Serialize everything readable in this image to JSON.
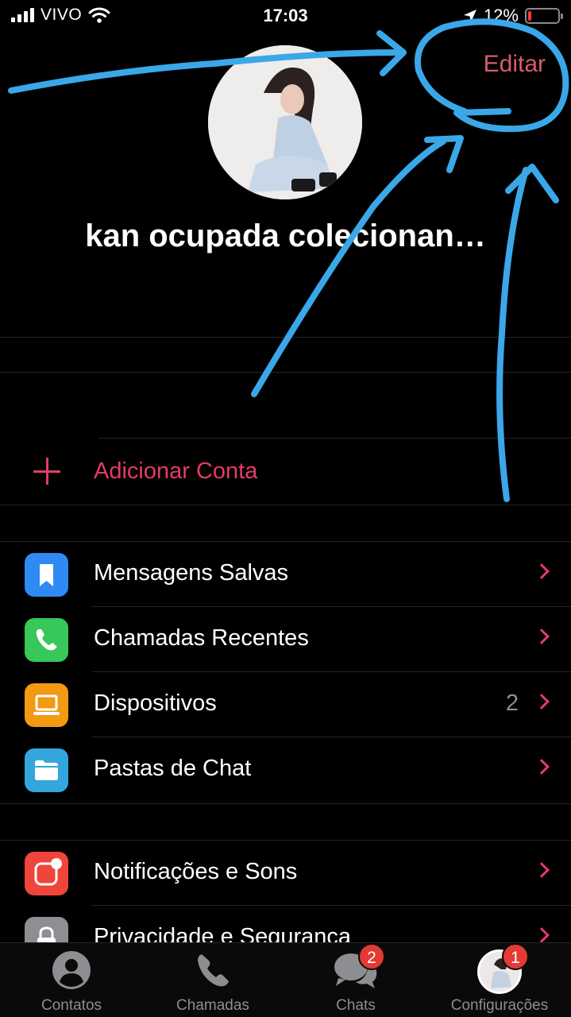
{
  "status_bar": {
    "carrier": "VIVO",
    "time": "17:03",
    "battery_percent": "12%",
    "battery_level": 0.12
  },
  "header": {
    "edit_label": "Editar",
    "profile_name": "kan ocupada colecionan…"
  },
  "add_account": {
    "label": "Adicionar Conta",
    "icon": "plus-icon"
  },
  "menu_group_1": [
    {
      "label": "Mensagens Salvas",
      "icon": "bookmark-icon",
      "color": "#2f8af4"
    },
    {
      "label": "Chamadas Recentes",
      "icon": "phone-icon",
      "color": "#37c75a"
    },
    {
      "label": "Dispositivos",
      "icon": "laptop-icon",
      "color": "#f29a12",
      "count": "2"
    },
    {
      "label": "Pastas de Chat",
      "icon": "folder-icon",
      "color": "#33a6de"
    }
  ],
  "menu_group_2": [
    {
      "label": "Notificações e Sons",
      "icon": "notification-icon",
      "color": "#f0453a"
    },
    {
      "label": "Privacidade e Segurança",
      "icon": "lock-icon",
      "color": "#8e8e93"
    }
  ],
  "tab_bar": {
    "tabs": [
      {
        "label": "Contatos",
        "icon": "person-icon"
      },
      {
        "label": "Chamadas",
        "icon": "phone-icon"
      },
      {
        "label": "Chats",
        "icon": "chat-bubbles-icon",
        "badge": "2"
      },
      {
        "label": "Configurações",
        "icon": "avatar-icon",
        "badge": "1"
      }
    ]
  },
  "colors": {
    "accent": "#e23c66",
    "edit": "#d65b6f",
    "annotation": "#3aa8e8",
    "badge": "#e53935"
  }
}
